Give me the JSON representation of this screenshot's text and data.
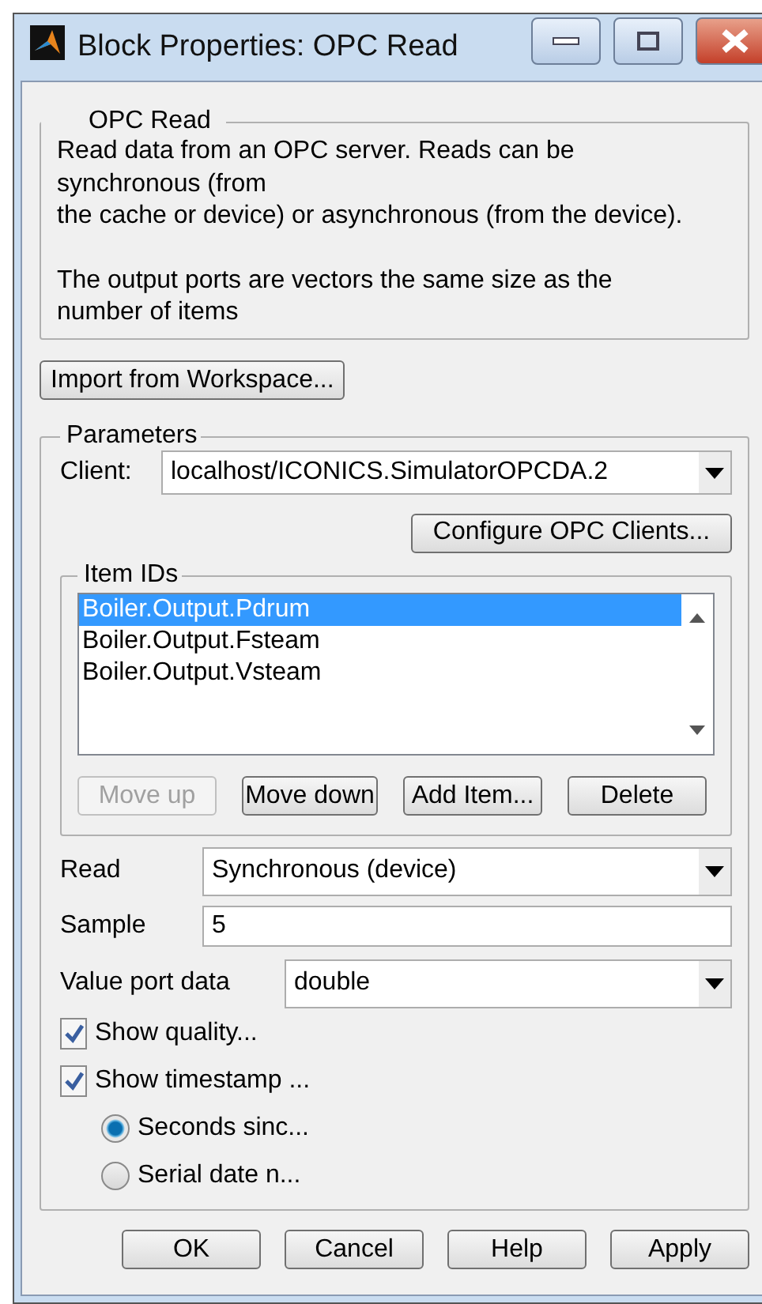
{
  "window": {
    "title": "Block Properties: OPC Read"
  },
  "description": {
    "title": "OPC Read",
    "paragraphs": [
      "Read data from an OPC server. Reads can be\nsynchronous (from\nthe cache or device) or asynchronous (from the device).",
      "The output ports are vectors the same size as the\nnumber of items"
    ]
  },
  "import_button": "Import from Workspace...",
  "parameters": {
    "title": "Parameters",
    "client": {
      "label": "Client:",
      "value": "localhost/ICONICS.SimulatorOPCDA.2"
    },
    "configure_button": "Configure OPC Clients...",
    "item_ids": {
      "title": "Item IDs",
      "items": [
        {
          "label": "Boiler.Output.Pdrum",
          "selected": true
        },
        {
          "label": "Boiler.Output.Fsteam",
          "selected": false
        },
        {
          "label": "Boiler.Output.Vsteam",
          "selected": false
        }
      ],
      "buttons": [
        {
          "label": "Move up",
          "disabled": true
        },
        {
          "label": "Move down",
          "disabled": false
        },
        {
          "label": "Add Item...",
          "disabled": false
        },
        {
          "label": "Delete",
          "disabled": false
        }
      ]
    },
    "read": {
      "label": "Read",
      "value": "Synchronous (device)"
    },
    "sample": {
      "label": "Sample",
      "value": "5"
    },
    "value_port_data": {
      "label": "Value port data",
      "value": "double"
    },
    "checkboxes": [
      {
        "label": "Show quality...",
        "checked": true
      },
      {
        "label": "Show timestamp ...",
        "checked": true
      }
    ],
    "radios": [
      {
        "label": "Seconds sinc...",
        "selected": true
      },
      {
        "label": "Serial date n...",
        "selected": false
      }
    ]
  },
  "buttons": [
    "OK",
    "Cancel",
    "Help",
    "Apply"
  ]
}
